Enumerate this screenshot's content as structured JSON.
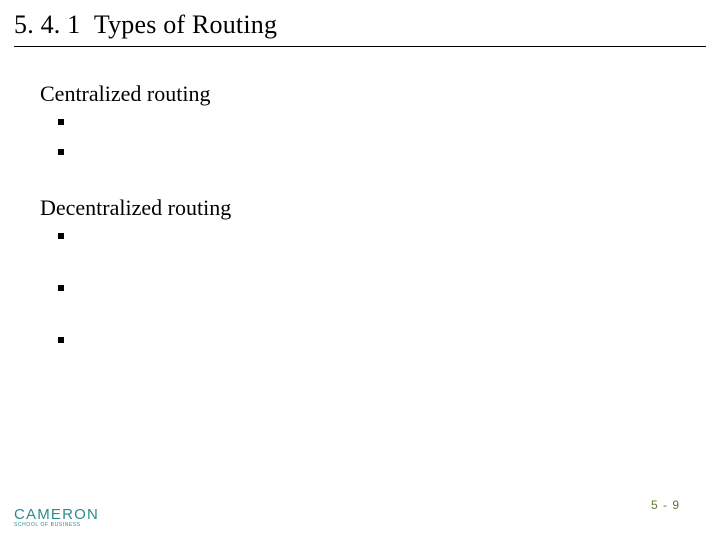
{
  "header": {
    "section_number": "5. 4. 1",
    "title": "Types of Routing"
  },
  "body": {
    "blocks": [
      {
        "heading": "Centralized routing",
        "bullets": [
          "",
          ""
        ],
        "spaced": false
      },
      {
        "heading": "Decentralized routing",
        "bullets": [
          "",
          "",
          ""
        ],
        "spaced": true
      }
    ]
  },
  "footer": {
    "logo_main": "CAMERON",
    "logo_sub": "School of Business",
    "page_label": "5 - 9"
  }
}
